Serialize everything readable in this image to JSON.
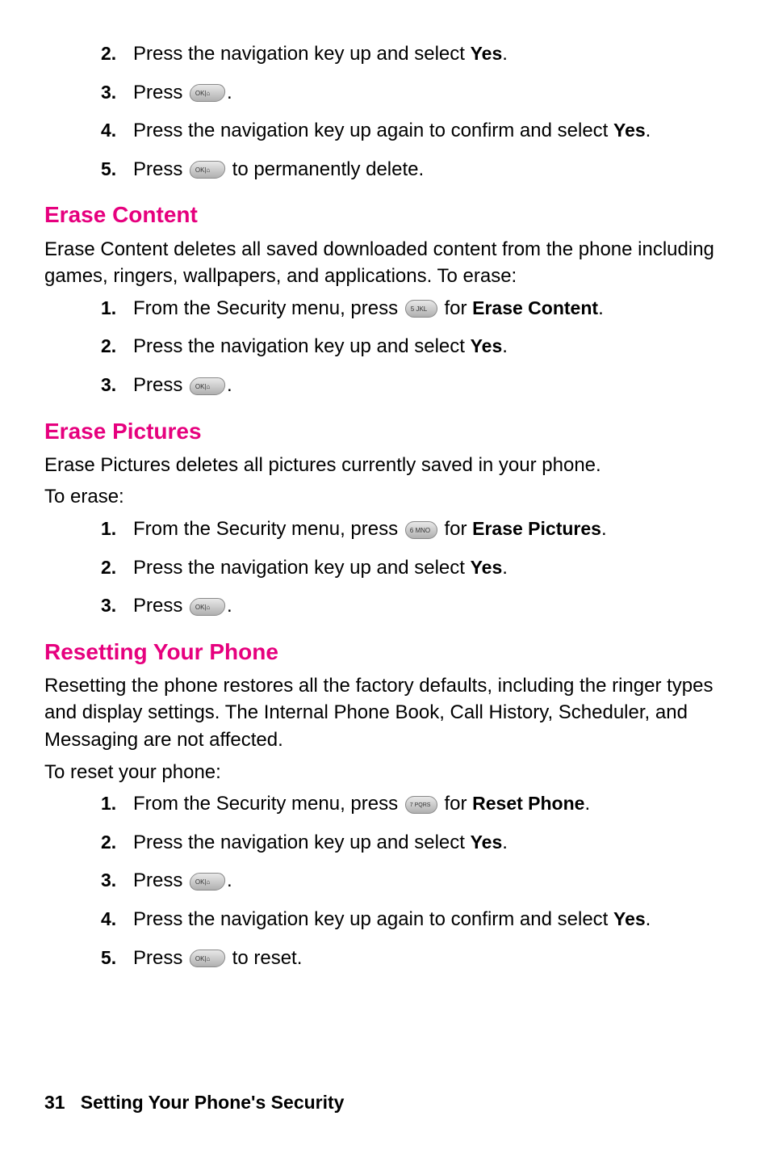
{
  "steps_top": {
    "s2": {
      "num": "2.",
      "text_a": "Press the navigation key up and select ",
      "bold": "Yes",
      "text_b": "."
    },
    "s3": {
      "num": "3.",
      "text_a": "Press ",
      "text_b": "."
    },
    "s4": {
      "num": "4.",
      "text_a": "Press the navigation key up again to confirm and select ",
      "bold": "Yes",
      "text_b": "."
    },
    "s5": {
      "num": "5.",
      "text_a": "Press ",
      "text_b": " to permanently delete."
    }
  },
  "erase_content": {
    "heading": "Erase Content",
    "intro": "Erase Content deletes all saved downloaded content from the phone including games, ringers, wallpapers, and applications. To erase:",
    "s1": {
      "num": "1.",
      "text_a": "From the Security menu, press ",
      "text_b": " for ",
      "bold": "Erase Content",
      "text_c": "."
    },
    "s2": {
      "num": "2.",
      "text_a": "Press the navigation key up and select ",
      "bold": "Yes",
      "text_b": "."
    },
    "s3": {
      "num": "3.",
      "text_a": "Press ",
      "text_b": "."
    }
  },
  "erase_pictures": {
    "heading": "Erase Pictures",
    "intro_a": "Erase Pictures deletes all pictures currently saved in your phone.",
    "intro_b": "To erase:",
    "s1": {
      "num": "1.",
      "text_a": "From the Security menu, press ",
      "text_b": " for ",
      "bold": "Erase Pictures",
      "text_c": "."
    },
    "s2": {
      "num": "2.",
      "text_a": "Press the navigation key up and select ",
      "bold": "Yes",
      "text_b": "."
    },
    "s3": {
      "num": "3.",
      "text_a": "Press ",
      "text_b": "."
    }
  },
  "resetting": {
    "heading": "Resetting Your Phone",
    "intro_a": "Resetting the phone restores all the factory defaults, including the ringer types and display settings. The Internal Phone Book, Call History, Scheduler, and Messaging are not affected.",
    "intro_b": "To reset your phone:",
    "s1": {
      "num": "1.",
      "text_a": "From the Security menu, press ",
      "text_b": " for ",
      "bold": "Reset Phone",
      "text_c": "."
    },
    "s2": {
      "num": "2.",
      "text_a": "Press the navigation key up and select ",
      "bold": "Yes",
      "text_b": "."
    },
    "s3": {
      "num": "3.",
      "text_a": "Press ",
      "text_b": "."
    },
    "s4": {
      "num": "4.",
      "text_a": "Press the navigation key up again to confirm and select ",
      "bold": "Yes",
      "text_b": "."
    },
    "s5": {
      "num": "5.",
      "text_a": "Press ",
      "text_b": " to reset."
    }
  },
  "footer": {
    "page": "31",
    "title": "Setting Your Phone's Security"
  }
}
